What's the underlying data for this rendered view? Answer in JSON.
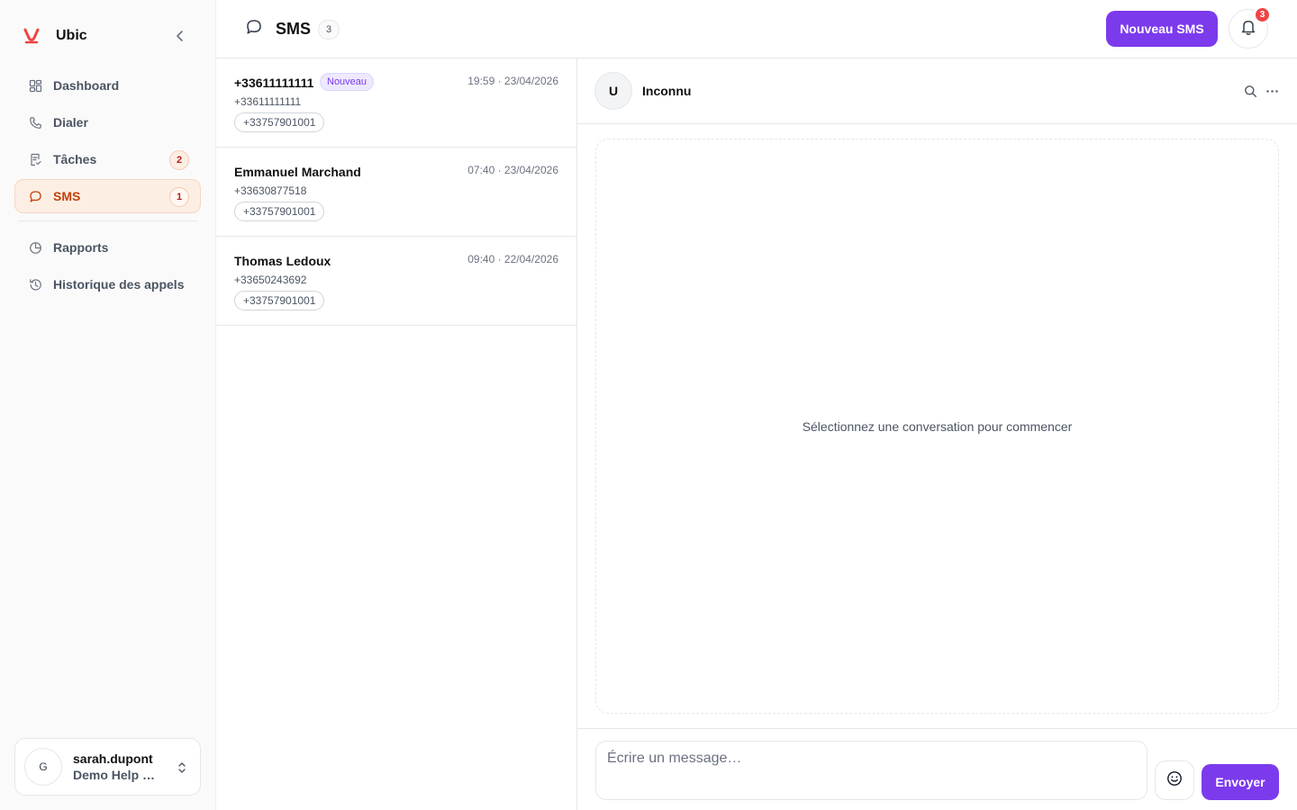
{
  "app": {
    "name": "Ubic"
  },
  "sidebar": {
    "items": [
      {
        "label": "Dashboard",
        "icon": "dashboard-icon"
      },
      {
        "label": "Dialer",
        "icon": "phone-icon"
      },
      {
        "label": "Tâches",
        "icon": "tasks-icon",
        "badge": "2"
      },
      {
        "label": "SMS",
        "icon": "message-icon",
        "badge": "1",
        "active": true
      },
      {
        "label": "Rapports",
        "icon": "pie-chart-icon"
      },
      {
        "label": "Historique des appels",
        "icon": "history-icon"
      }
    ],
    "user": {
      "initial": "G",
      "name": "sarah.dupont",
      "org": "Demo Help Center"
    }
  },
  "header": {
    "title": "SMS",
    "count": "3",
    "new_button": "Nouveau SMS",
    "notification_count": "3"
  },
  "conversations": [
    {
      "name": "+33611111111",
      "new_label": "Nouveau",
      "time": "19:59 · 23/04/2026",
      "phone": "+33611111111",
      "line": "+33757901001"
    },
    {
      "name": "Emmanuel Marchand",
      "time": "07:40 · 23/04/2026",
      "phone": "+33630877518",
      "line": "+33757901001"
    },
    {
      "name": "Thomas Ledoux",
      "time": "09:40 · 22/04/2026",
      "phone": "+33650243692",
      "line": "+33757901001"
    }
  ],
  "thread": {
    "avatar": "U",
    "contact_name": "Inconnu",
    "empty_text": "Sélectionnez une conversation pour commencer",
    "composer_placeholder": "Écrire un message…",
    "send_label": "Envoyer"
  },
  "colors": {
    "accent": "#7c3aed",
    "active_nav_bg": "#fdeee4",
    "active_nav_text": "#c2410c",
    "badge_red": "#ef4444"
  }
}
